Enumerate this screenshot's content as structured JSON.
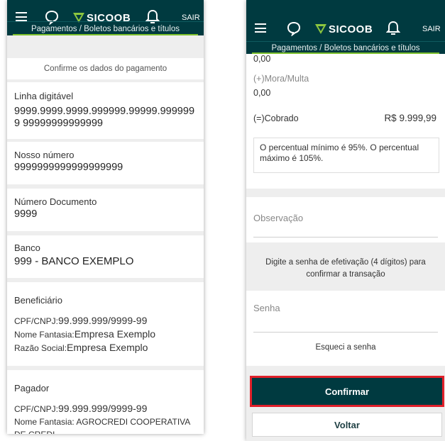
{
  "header": {
    "logo_text": "SICOOB",
    "logout_label": "SAIR",
    "breadcrumb": "Pagamentos / Boletos bancários e títulos",
    "colors": {
      "bar": "#003a40",
      "accent": "#7dbf2c",
      "logo_mark": "#8cc63f"
    }
  },
  "left": {
    "confirm_title": "Confirme os dados do pagamento",
    "linha": {
      "label": "Linha digitável",
      "value_line1": "9999.9999.9999.999999.99999.999999",
      "value_line2": "9 99999999999999"
    },
    "nosso": {
      "label": "Nosso número",
      "value": "9999999999999999999"
    },
    "documento": {
      "label": "Número Documento",
      "value": "9999"
    },
    "banco": {
      "label": "Banco",
      "code": "999",
      "name": "BANCO EXEMPLO"
    },
    "beneficiario": {
      "title": "Beneficiário",
      "cpf_label": "CPF/CNPJ:",
      "cpf_value": "99.999.999/9999-99",
      "fantasia_label": "Nome Fantasia:",
      "fantasia_value": "Empresa Exemplo",
      "razao_label": "Razão Social:",
      "razao_value": "Empresa Exemplo"
    },
    "pagador": {
      "title": "Pagador",
      "cpf_label": "CPF/CNPJ:",
      "cpf_value": "99.999.999/9999-99",
      "fantasia_label": "Nome Fantasia:",
      "fantasia_value": "AGROCREDI COOPERATIVA",
      "fantasia_value_2": "DE CREDI"
    }
  },
  "right": {
    "top_value": "0,00",
    "mora_label": "(+)Mora/Multa",
    "mora_value": "0,00",
    "cobrado_label": "(=)Cobrado",
    "cobrado_value": "R$ 9.999,99",
    "percent_note_1": "O percentual mínimo é 95%. O percentual",
    "percent_note_2": "máximo é 105%.",
    "observacao_placeholder": "Observação",
    "senha_instruction_1": "Digite a senha de efetivação (4 dígitos) para",
    "senha_instruction_2": "confirmar a transação",
    "senha_placeholder": "Senha",
    "forgot_link": "Esqueci a senha",
    "confirm_button": "Confirmar",
    "back_button": "Voltar",
    "highlight_color": "#e0202a"
  }
}
